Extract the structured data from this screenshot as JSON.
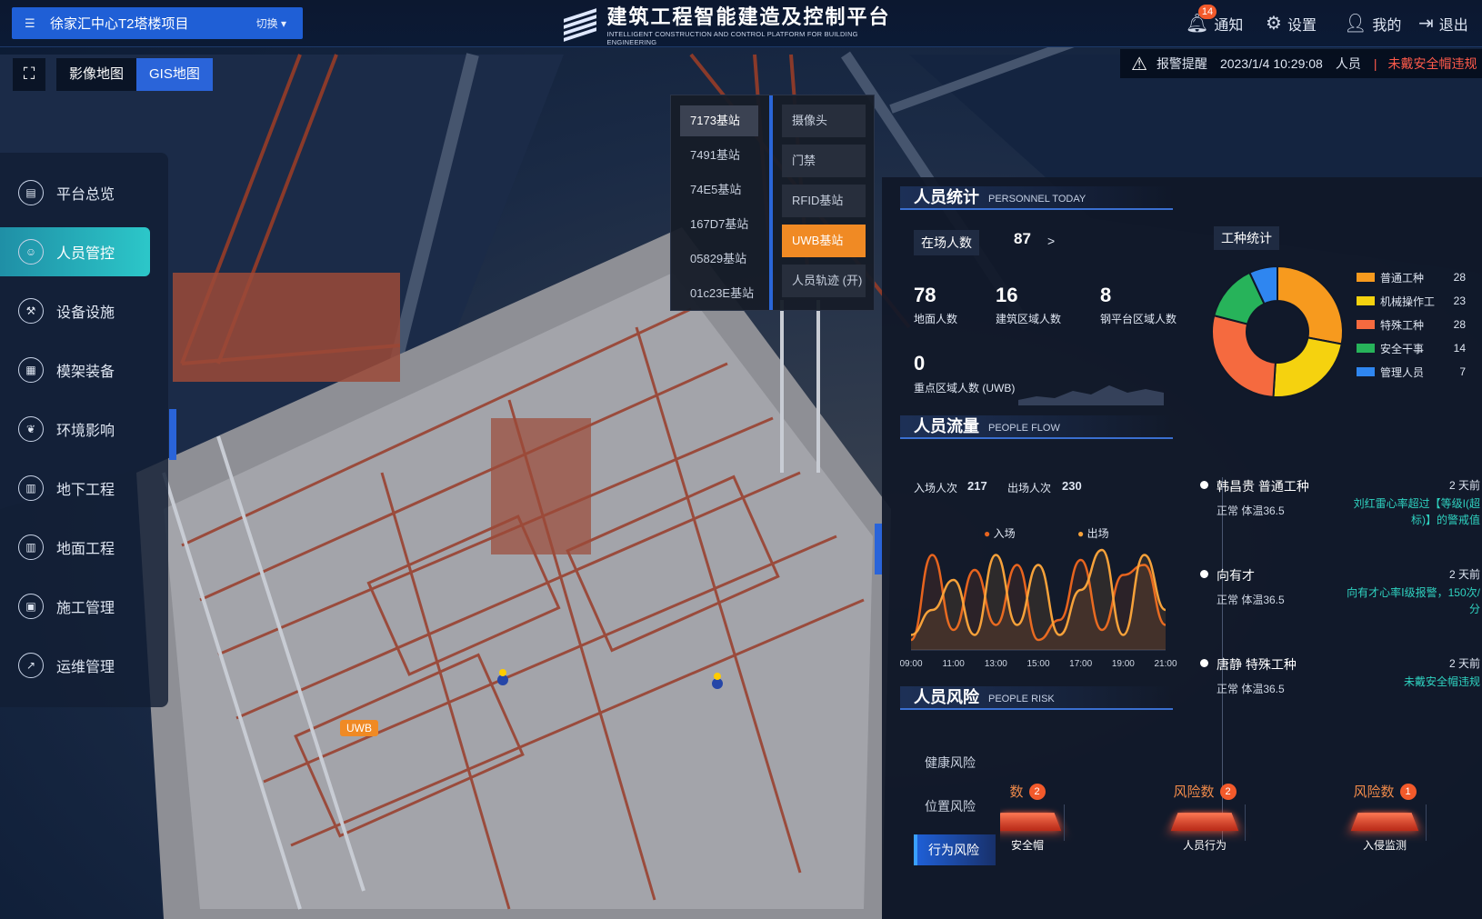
{
  "header": {
    "project_name": "徐家汇中心T2塔楼项目",
    "switch_label": "切换",
    "title_zh": "建筑工程智能建造及控制平台",
    "title_en": "INTELLIGENT CONSTRUCTION AND CONTROL PLATFORM FOR BUILDING ENGINEERING",
    "notification_label": "通知",
    "notification_count": "14",
    "settings_label": "设置",
    "profile_label": "我的",
    "logout_label": "退出"
  },
  "alarm": {
    "label": "报警提醒",
    "datetime": "2023/1/4 10:29:08",
    "type": "人员",
    "message": "未戴安全帽违规"
  },
  "map_toggle": {
    "options": [
      "影像地图",
      "GIS地图"
    ],
    "active": "GIS地图"
  },
  "sidebar": {
    "items": [
      {
        "label": "平台总览",
        "icon": "overview-icon"
      },
      {
        "label": "人员管控",
        "icon": "personnel-icon",
        "active": true
      },
      {
        "label": "设备设施",
        "icon": "equipment-icon"
      },
      {
        "label": "模架装备",
        "icon": "formwork-icon"
      },
      {
        "label": "环境影响",
        "icon": "environment-icon"
      },
      {
        "label": "地下工程",
        "icon": "underground-icon"
      },
      {
        "label": "地面工程",
        "icon": "ground-icon"
      },
      {
        "label": "施工管理",
        "icon": "construction-icon"
      },
      {
        "label": "运维管理",
        "icon": "maintenance-icon"
      }
    ]
  },
  "map": {
    "uwb_tag": "UWB"
  },
  "stations": {
    "items": [
      "7173基站",
      "7491基站",
      "74E5基站",
      "167D7基站",
      "05829基站",
      "01c23E基站"
    ],
    "active": "7173基站",
    "devices": [
      "摄像头",
      "门禁",
      "RFID基站",
      "UWB基站",
      "人员轨迹 (开)"
    ],
    "active_device": "UWB基站"
  },
  "personnel_stats": {
    "title_zh": "人员统计",
    "title_en": "PERSONNEL TODAY",
    "onsite_label": "在场人数",
    "onsite_value": "87",
    "onsite_arrow": ">",
    "ground_value": "78",
    "ground_label": "地面人数",
    "building_value": "16",
    "building_label": "建筑区域人数",
    "steel_value": "8",
    "steel_label": "钢平台区域人数",
    "key_value": "0",
    "key_label": "重点区域人数 (UWB)",
    "worktype_title": "工种统计",
    "worktypes": [
      {
        "name": "普通工种",
        "value": 28,
        "color": "#f79a1e"
      },
      {
        "name": "机械操作工",
        "value": 23,
        "color": "#f5d20f"
      },
      {
        "name": "特殊工种",
        "value": 28,
        "color": "#f56a3f"
      },
      {
        "name": "安全干事",
        "value": 14,
        "color": "#27b35a"
      },
      {
        "name": "管理人员",
        "value": 7,
        "color": "#2f86f0"
      }
    ]
  },
  "people_flow": {
    "title_zh": "人员流量",
    "title_en": "PEOPLE FLOW",
    "in_label": "入场人次",
    "in_value": "217",
    "out_label": "出场人次",
    "out_value": "230",
    "legend_in": "入场",
    "legend_out": "出场",
    "x_ticks": [
      "09:00",
      "11:00",
      "13:00",
      "15:00",
      "17:00",
      "19:00",
      "21:00"
    ]
  },
  "chart_data": {
    "type": "line",
    "x": [
      "09:00",
      "10:00",
      "11:00",
      "12:00",
      "13:00",
      "14:00",
      "15:00",
      "16:00",
      "17:00",
      "18:00",
      "19:00",
      "20:00",
      "21:00"
    ],
    "series": [
      {
        "name": "入场",
        "color": "#e8641e",
        "values": [
          10,
          95,
          20,
          80,
          25,
          85,
          10,
          30,
          90,
          20,
          75,
          85,
          25
        ]
      },
      {
        "name": "出场",
        "color": "#f7a23a",
        "values": [
          15,
          40,
          70,
          15,
          95,
          25,
          85,
          15,
          60,
          100,
          15,
          95,
          40
        ]
      }
    ]
  },
  "timeline": [
    {
      "name": "韩昌贵 普通工种",
      "ago": "2 天前",
      "status": "正常 体温36.5",
      "note": "刘红雷心率超过【等级I(超标)】的警戒值"
    },
    {
      "name": "向有才",
      "ago": "2 天前",
      "status": "正常 体温36.5",
      "note": "向有才心率Ⅰ级报警，150次/分"
    },
    {
      "name": "唐静 特殊工种",
      "ago": "2 天前",
      "status": "正常 体温36.5",
      "note": "未戴安全帽违规"
    }
  ],
  "people_risk": {
    "title_zh": "人员风险",
    "title_en": "PEOPLE RISK",
    "tabs": [
      "健康风险",
      "位置风险",
      "行为风险"
    ],
    "active_tab": "行为风险",
    "columns": [
      {
        "title": "数",
        "count": "2",
        "label": "安全帽"
      },
      {
        "title": "风险数",
        "count": "2",
        "label": "人员行为"
      },
      {
        "title": "风险数",
        "count": "1",
        "label": "入侵监测"
      }
    ]
  }
}
